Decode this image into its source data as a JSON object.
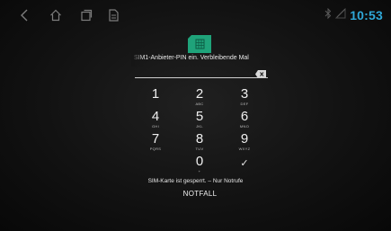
{
  "status_bar": {
    "nav_icons": [
      "back-icon",
      "home-icon",
      "recents-icon",
      "sim-card-icon"
    ],
    "clock": "10:53",
    "indicators": [
      "bluetooth-icon",
      "no-signal-icon"
    ],
    "accent_color": "#2fa8d8"
  },
  "lock": {
    "icon": "sim-card-icon",
    "icon_color": "#1fa37a",
    "prompt": "n SIM1-Anbieter-PIN ein. Verbleibende Mal",
    "pin_value": "",
    "backspace_icon": "backspace-icon"
  },
  "keypad": {
    "keys": [
      {
        "num": "1",
        "letters": ""
      },
      {
        "num": "2",
        "letters": "ABC"
      },
      {
        "num": "3",
        "letters": "DEF"
      },
      {
        "num": "4",
        "letters": "GHI"
      },
      {
        "num": "5",
        "letters": "JKL"
      },
      {
        "num": "6",
        "letters": "MNO"
      },
      {
        "num": "7",
        "letters": "PQRS"
      },
      {
        "num": "8",
        "letters": "TUV"
      },
      {
        "num": "9",
        "letters": "WXYZ"
      },
      {
        "num": "0",
        "letters": "+"
      }
    ],
    "confirm": "✓"
  },
  "footer": {
    "locked_text": "SIM-Karte ist gesperrt. – Nur Notrufe",
    "emergency_label": "NOTFALL"
  }
}
